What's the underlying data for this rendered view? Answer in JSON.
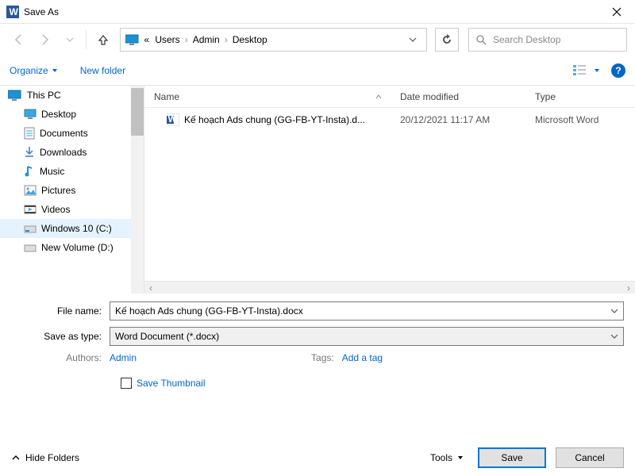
{
  "title": "Save As",
  "nav": {
    "breadcrumbs": [
      "Users",
      "Admin",
      "Desktop"
    ],
    "search_placeholder": "Search Desktop"
  },
  "toolbar": {
    "organize": "Organize",
    "new_folder": "New folder"
  },
  "tree": {
    "root": "This PC",
    "items": [
      {
        "label": "Desktop",
        "icon": "desktop"
      },
      {
        "label": "Documents",
        "icon": "documents"
      },
      {
        "label": "Downloads",
        "icon": "downloads"
      },
      {
        "label": "Music",
        "icon": "music"
      },
      {
        "label": "Pictures",
        "icon": "pictures"
      },
      {
        "label": "Videos",
        "icon": "videos"
      },
      {
        "label": "Windows 10 (C:)",
        "icon": "drive"
      },
      {
        "label": "New Volume (D:)",
        "icon": "drive"
      }
    ],
    "selected_index": 6
  },
  "columns": {
    "name": "Name",
    "date": "Date modified",
    "type": "Type"
  },
  "files": [
    {
      "name": "Kế hoạch Ads chung (GG-FB-YT-Insta).d...",
      "date": "20/12/2021 11:17 AM",
      "type": "Microsoft Word"
    }
  ],
  "form": {
    "filename_label": "File name:",
    "filename_value": "Kế hoạch Ads chung (GG-FB-YT-Insta).docx",
    "saveas_label": "Save as type:",
    "saveas_value": "Word Document (*.docx)",
    "authors_label": "Authors:",
    "authors_value": "Admin",
    "tags_label": "Tags:",
    "tags_value": "Add a tag",
    "save_thumbnail": "Save Thumbnail"
  },
  "footer": {
    "hide_folders": "Hide Folders",
    "tools": "Tools",
    "save": "Save",
    "cancel": "Cancel"
  }
}
